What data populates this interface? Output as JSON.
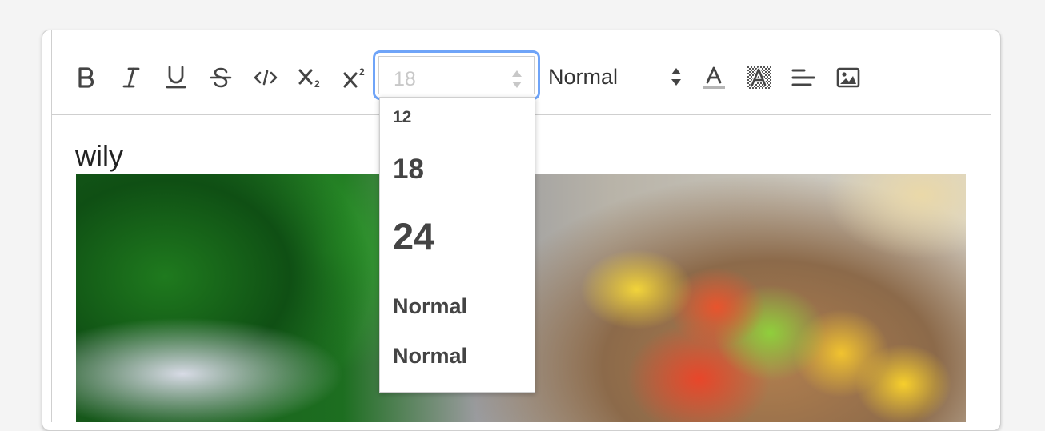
{
  "toolbar": {
    "buttons": [
      {
        "name": "bold",
        "icon": "bold-icon"
      },
      {
        "name": "italic",
        "icon": "italic-icon"
      },
      {
        "name": "underline",
        "icon": "underline-icon"
      },
      {
        "name": "strike",
        "icon": "strikethrough-icon"
      },
      {
        "name": "code",
        "icon": "code-icon"
      },
      {
        "name": "subscript",
        "icon": "subscript-icon"
      },
      {
        "name": "superscript",
        "icon": "superscript-icon"
      }
    ],
    "size_select": {
      "value": "18"
    },
    "header_select": {
      "value": "Normal"
    },
    "right_buttons": [
      {
        "name": "font-color",
        "icon": "text-color-icon"
      },
      {
        "name": "background-color",
        "icon": "text-background-icon"
      },
      {
        "name": "align",
        "icon": "align-left-icon"
      },
      {
        "name": "image",
        "icon": "image-icon"
      }
    ]
  },
  "size_dropdown": {
    "options": [
      "12",
      "18",
      "24",
      "Normal",
      "Normal"
    ]
  },
  "content": {
    "text": "wily"
  },
  "colors": {
    "focus_ring": "#6fa4f8",
    "border": "#cfcfcf",
    "icon": "#444444"
  }
}
